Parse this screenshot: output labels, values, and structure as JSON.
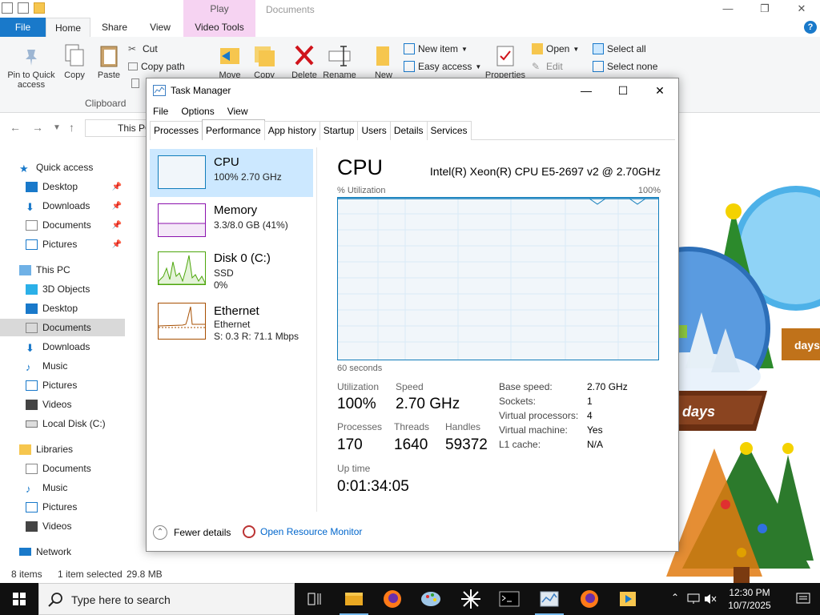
{
  "explorer": {
    "title": "Documents",
    "play_tab": "Play",
    "tabs": [
      "File",
      "Home",
      "Share",
      "View",
      "Video Tools"
    ],
    "ribbon": {
      "pin_label_1": "Pin to Quick",
      "pin_label_2": "access",
      "copy": "Copy",
      "paste": "Paste",
      "cut": "Cut",
      "copy_path": "Copy path",
      "move": "Move",
      "copy2": "Copy",
      "delete": "Delete",
      "rename": "Rename",
      "new": "New",
      "new_item": "New item",
      "easy_access": "Easy access",
      "properties": "Properties",
      "open": "Open",
      "edit": "Edit",
      "select_all": "Select all",
      "select_none": "Select none",
      "clipboard_group": "Clipboard"
    },
    "address": "This PC",
    "nav": {
      "quick_access": "Quick access",
      "qa_items": [
        "Desktop",
        "Downloads",
        "Documents",
        "Pictures"
      ],
      "this_pc": "This PC",
      "pc_items": [
        "3D Objects",
        "Desktop",
        "Documents",
        "Downloads",
        "Music",
        "Pictures",
        "Videos",
        "Local Disk (C:)"
      ],
      "libraries": "Libraries",
      "lib_items": [
        "Documents",
        "Music",
        "Pictures",
        "Videos"
      ],
      "network": "Network"
    },
    "status": {
      "items": "8 items",
      "selected": "1 item selected",
      "size": "29.8 MB"
    }
  },
  "taskmgr": {
    "title": "Task Manager",
    "menu": [
      "File",
      "Options",
      "View"
    ],
    "tabs": [
      "Processes",
      "Performance",
      "App history",
      "Startup",
      "Users",
      "Details",
      "Services"
    ],
    "resources": {
      "cpu": {
        "name": "CPU",
        "sub": "100%  2.70 GHz"
      },
      "memory": {
        "name": "Memory",
        "sub": "3.3/8.0 GB (41%)"
      },
      "disk": {
        "name": "Disk 0 (C:)",
        "sub1": "SSD",
        "sub2": "0%"
      },
      "ethernet": {
        "name": "Ethernet",
        "sub1": "Ethernet",
        "sub2": "S: 0.3  R: 71.1 Mbps"
      }
    },
    "detail": {
      "title": "CPU",
      "model": "Intel(R) Xeon(R) CPU E5-2697 v2 @ 2.70GHz",
      "util_label": "% Utilization",
      "util_max": "100%",
      "time_label": "60 seconds",
      "utilization_lbl": "Utilization",
      "utilization_val": "100%",
      "speed_lbl": "Speed",
      "speed_val": "2.70 GHz",
      "processes_lbl": "Processes",
      "processes_val": "170",
      "threads_lbl": "Threads",
      "threads_val": "1640",
      "handles_lbl": "Handles",
      "handles_val": "59372",
      "uptime_lbl": "Up time",
      "uptime_val": "0:01:34:05",
      "base_speed_k": "Base speed:",
      "base_speed_v": "2.70 GHz",
      "sockets_k": "Sockets:",
      "sockets_v": "1",
      "vproc_k": "Virtual processors:",
      "vproc_v": "4",
      "vm_k": "Virtual machine:",
      "vm_v": "Yes",
      "l1_k": "L1 cache:",
      "l1_v": "N/A"
    },
    "footer": {
      "fewer": "Fewer details",
      "resmon": "Open Resource Monitor"
    }
  },
  "deco": {
    "days": "78 days",
    "days_small": "days"
  },
  "taskbar": {
    "search_placeholder": "Type here to search",
    "time": "12:30 PM",
    "date": "10/7/2025"
  },
  "colors": {
    "accent": "#1979ca",
    "cpu_graph": "#117dbb",
    "memory_graph": "#8b12ae",
    "disk_graph": "#4da60c",
    "ethernet_graph": "#a74f01"
  }
}
